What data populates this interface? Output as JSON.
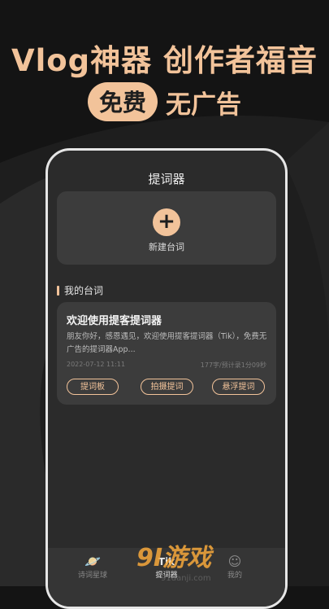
{
  "headline": "Vlog神器 创作者福音",
  "sub_badge": "免费",
  "sub_text": "无广告",
  "app": {
    "title": "提词器",
    "new_button_label": "新建台词",
    "section_title": "我的台词",
    "script_card": {
      "title": "欢迎使用提客提词器",
      "description": "朋友你好，感恩遇见，欢迎使用提客提词器（Tik），免费无广告的提词器App...",
      "date": "2022-07-12 11:11",
      "stats": "177字/预计录1分09秒",
      "buttons": [
        "提词板",
        "拍摄提词",
        "悬浮提词"
      ]
    },
    "tabs": [
      {
        "label": "诗词星球",
        "icon": "planet-icon"
      },
      {
        "label": "提词器",
        "icon": "tik-icon"
      },
      {
        "label": "我的",
        "icon": "smile-icon"
      }
    ]
  },
  "watermark": {
    "text": "9I游戏",
    "sub": "91danji.com"
  },
  "colors": {
    "accent": "#f2c39a",
    "background": "#141414",
    "phone_bg": "#2b2b2b",
    "card": "#3c3c3c"
  }
}
